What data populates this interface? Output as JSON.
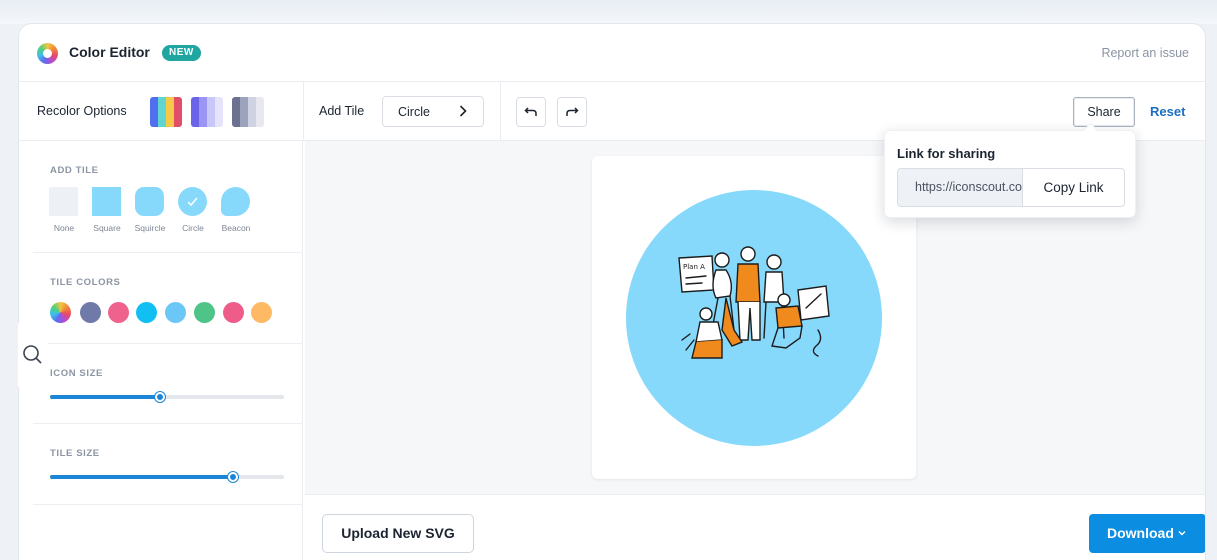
{
  "app": {
    "title": "Color Editor",
    "badge": "NEW",
    "report_link": "Report an issue"
  },
  "toolbar": {
    "recolor_label": "Recolor Options",
    "add_tile_label": "Add Tile",
    "tile_shape_value": "Circle",
    "share_label": "Share",
    "reset_label": "Reset"
  },
  "palettes": [
    {
      "colors": [
        "#4f6ff0",
        "#5fd6d0",
        "#f6c94a",
        "#e24e6a"
      ]
    },
    {
      "colors": [
        "#6b63e8",
        "#9a94f2",
        "#c9c6f8",
        "#e6e4fb"
      ]
    },
    {
      "colors": [
        "#6c7190",
        "#9ea3bd",
        "#cfd2e0",
        "#e8e9f0"
      ]
    }
  ],
  "sidebar": {
    "add_tile_title": "ADD TILE",
    "tiles": [
      {
        "label": "None"
      },
      {
        "label": "Square"
      },
      {
        "label": "Squircle"
      },
      {
        "label": "Circle"
      },
      {
        "label": "Beacon"
      }
    ],
    "tile_colors_title": "TILE COLORS",
    "swatches": [
      "#6f7aa8",
      "#f0628e",
      "#12bff2",
      "#6cc6f6",
      "#4ec488",
      "#ee5d8a",
      "#fdb964"
    ],
    "icon_size_title": "ICON SIZE",
    "icon_size_value": 0.47,
    "tile_size_title": "TILE SIZE",
    "tile_size_value": 0.78
  },
  "share_popover": {
    "title": "Link for sharing",
    "link_value": "https://iconscout.com",
    "copy_label": "Copy Link"
  },
  "footer": {
    "upload_label": "Upload New SVG",
    "download_label": "Download"
  },
  "colors": {
    "accent": "#0b8de1",
    "tile_bg": "#87d9fb",
    "illustration_accent": "#f08a1d"
  }
}
